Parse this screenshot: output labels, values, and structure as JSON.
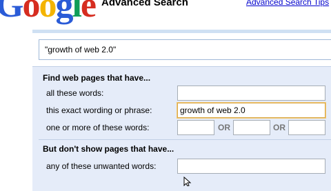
{
  "header": {
    "logo_text": "Google",
    "title": "Advanced Search",
    "tips_link": "Advanced Search Tips"
  },
  "query": {
    "value": "\"growth of web 2.0\""
  },
  "find_section": {
    "heading": "Find web pages that have...",
    "all_words_label": "all these words:",
    "all_words_value": "",
    "exact_phrase_label": "this exact wording or phrase:",
    "exact_phrase_value": "growth of web 2.0",
    "one_or_more_label": "one or more of these words:",
    "or_label": "OR",
    "one_or_more_values": [
      "",
      "",
      ""
    ]
  },
  "exclude_section": {
    "heading": "But don't show pages that have...",
    "unwanted_label": "any of these unwanted words:",
    "unwanted_value": ""
  },
  "colors": {
    "panel_bg": "#e5ecf9",
    "link": "#0000cc",
    "focus_border": "#d9a84a"
  }
}
